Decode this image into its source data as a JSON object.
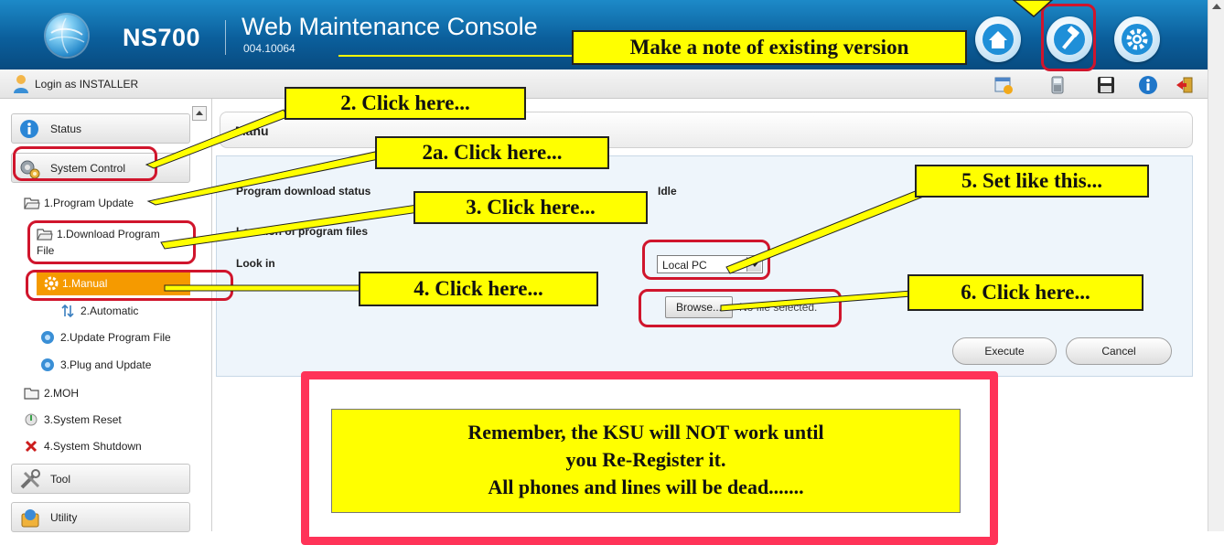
{
  "header": {
    "model": "NS700",
    "console_title": "Web Maintenance Console",
    "version": "004.10064",
    "buttons": [
      {
        "icon": "home-icon"
      },
      {
        "icon": "hammer-icon"
      },
      {
        "icon": "gear-icon"
      }
    ]
  },
  "toolbar": {
    "login_text": "Login as INSTALLER",
    "icons": [
      "calendar-icon",
      "phone-icon",
      "save-icon",
      "info-icon",
      "logout-icon"
    ]
  },
  "sidebar": {
    "status": "Status",
    "system_control": "System Control",
    "program_update": "1.Program Update",
    "download_program_file_line1": "1.Download Program",
    "download_program_file_line2": "File",
    "manual": "1.Manual",
    "automatic": "2.Automatic",
    "update_program_file": "2.Update Program File",
    "plug_and_update": "3.Plug and Update",
    "moh": "2.MOH",
    "system_reset": "3.System Reset",
    "system_shutdown": "4.System Shutdown",
    "tool": "Tool",
    "utility": "Utility"
  },
  "main": {
    "title_visible": "Manu",
    "program_download_status_label": "Program download status",
    "program_download_status_value": "Idle",
    "location_label": "Location of program files",
    "look_in_label": "Look in",
    "look_in_value": "Local PC",
    "browse_label": "Browse...",
    "no_file_text": "No file selected.",
    "execute_label": "Execute",
    "cancel_label": "Cancel"
  },
  "annotations": {
    "note_version": "Make a note of existing version",
    "step2": "2. Click here...",
    "step2a": "2a. Click here...",
    "step3": "3. Click here...",
    "step4": "4. Click here...",
    "step5": "5. Set like this...",
    "step6": "6. Click here...",
    "reminder_line1": "Remember, the KSU will NOT work until",
    "reminder_line2": "you Re-Register it.",
    "reminder_line3": "All phones and lines will be dead......."
  },
  "colors": {
    "header_blue": "#0b5f9c",
    "selected_orange": "#f59a00",
    "callout_yellow": "#ffff00",
    "highlight_red": "#d0152c",
    "frame_pink": "#ff3358"
  }
}
